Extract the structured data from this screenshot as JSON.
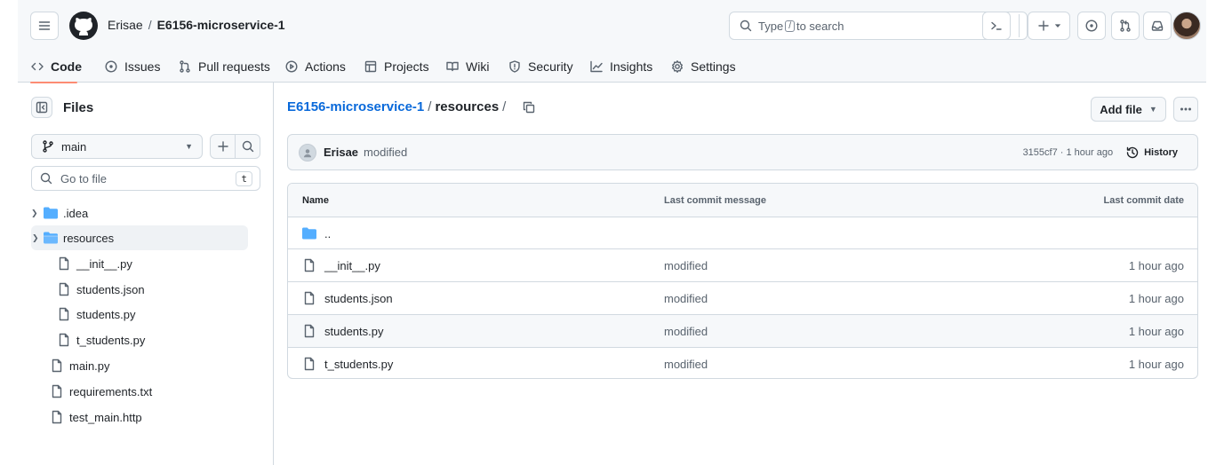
{
  "header": {
    "owner": "Erisae",
    "separator": "/",
    "repo": "E6156-microservice-1",
    "search": {
      "prefix": "Type",
      "key": "/",
      "suffix": "to search"
    }
  },
  "tabs": [
    {
      "label": "Code",
      "icon": "code-icon"
    },
    {
      "label": "Issues",
      "icon": "issue-icon"
    },
    {
      "label": "Pull requests",
      "icon": "pull-request-icon"
    },
    {
      "label": "Actions",
      "icon": "play-icon"
    },
    {
      "label": "Projects",
      "icon": "table-icon"
    },
    {
      "label": "Wiki",
      "icon": "book-icon"
    },
    {
      "label": "Security",
      "icon": "shield-icon"
    },
    {
      "label": "Insights",
      "icon": "graph-icon"
    },
    {
      "label": "Settings",
      "icon": "gear-icon"
    }
  ],
  "sidebar": {
    "title": "Files",
    "branch": "main",
    "goto_placeholder": "Go to file",
    "goto_key": "t",
    "tree": [
      {
        "label": ".idea",
        "type": "folder"
      },
      {
        "label": "resources",
        "type": "folder-open"
      },
      {
        "label": "__init__.py",
        "type": "file"
      },
      {
        "label": "students.json",
        "type": "file"
      },
      {
        "label": "students.py",
        "type": "file"
      },
      {
        "label": "t_students.py",
        "type": "file"
      },
      {
        "label": "main.py",
        "type": "file"
      },
      {
        "label": "requirements.txt",
        "type": "file"
      },
      {
        "label": "test_main.http",
        "type": "file"
      }
    ]
  },
  "breadcrumb": {
    "repo": "E6156-microservice-1",
    "sep1": "/",
    "current": "resources",
    "sep2": "/"
  },
  "actions": {
    "add_file": "Add file"
  },
  "commit": {
    "author": "Erisae",
    "message": "modified",
    "meta": "3155cf7 · 1 hour ago",
    "history": "History"
  },
  "table": {
    "headers": [
      "Name",
      "Last commit message",
      "Last commit date"
    ],
    "parent": "..",
    "rows": [
      {
        "name": "__init__.py",
        "message": "modified",
        "date": "1 hour ago"
      },
      {
        "name": "students.json",
        "message": "modified",
        "date": "1 hour ago"
      },
      {
        "name": "students.py",
        "message": "modified",
        "date": "1 hour ago"
      },
      {
        "name": "t_students.py",
        "message": "modified",
        "date": "1 hour ago"
      }
    ]
  },
  "colors": {
    "accent_link": "#0969da",
    "folder": "#54aeff",
    "tab_underline": "#fd8c73"
  }
}
